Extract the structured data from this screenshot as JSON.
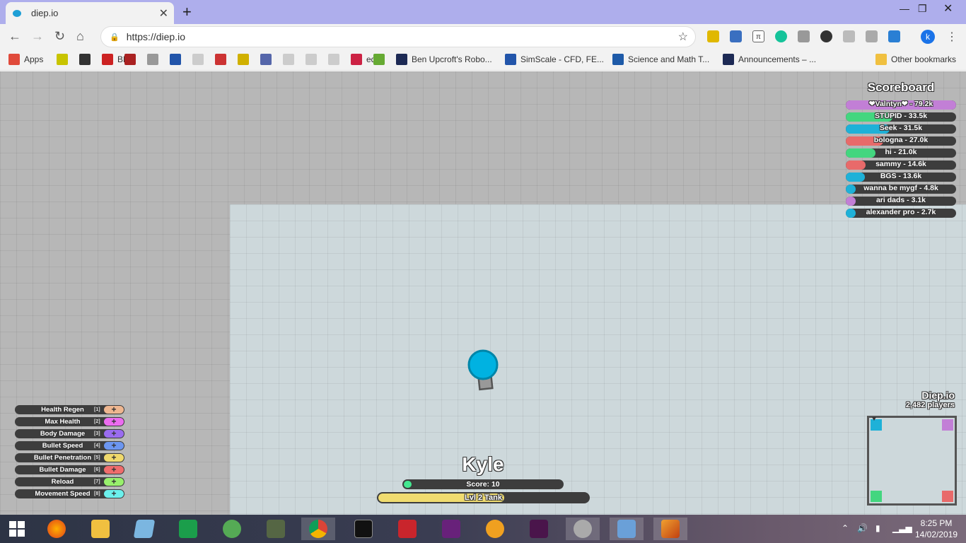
{
  "browser": {
    "tab_title": "diep.io",
    "url": "https://diep.io",
    "bookmarks": [
      {
        "label": "Apps",
        "color": "#e04a3b"
      },
      {
        "label": "",
        "color": "#c8c400"
      },
      {
        "label": "",
        "color": "#333333"
      },
      {
        "label": "BE",
        "color": "#cc2222"
      },
      {
        "label": "",
        "color": "#aa2222"
      },
      {
        "label": "",
        "color": "#999999"
      },
      {
        "label": "",
        "color": "#2255aa"
      },
      {
        "label": "",
        "color": "#cccccc"
      },
      {
        "label": "",
        "color": "#cc3333"
      },
      {
        "label": "",
        "color": "#d0b000"
      },
      {
        "label": "",
        "color": "#5566aa"
      },
      {
        "label": "",
        "color": "#cccccc"
      },
      {
        "label": "",
        "color": "#cccccc"
      },
      {
        "label": "",
        "color": "#cccccc"
      },
      {
        "label": "edX",
        "color": "#cc2244"
      },
      {
        "label": "",
        "color": "#66aa33"
      },
      {
        "label": "Ben Upcroft's Robo...",
        "color": "#1d2a55"
      },
      {
        "label": "SimScale - CFD, FE...",
        "color": "#2255aa"
      },
      {
        "label": "Science and Math T...",
        "color": "#1e5aa8"
      },
      {
        "label": "Announcements – ...",
        "color": "#1d2a55"
      }
    ],
    "other_bookmarks": "Other bookmarks"
  },
  "scoreboard": {
    "title": "Scoreboard",
    "entries": [
      {
        "label": "❤Valntyn❤ - 79.2k",
        "fraction": 1.0,
        "color": "#c27fd6"
      },
      {
        "label": "STUPID - 33.5k",
        "fraction": 0.42,
        "color": "#43d67f"
      },
      {
        "label": "Seek - 31.5k",
        "fraction": 0.4,
        "color": "#1eb1d8"
      },
      {
        "label": "bologna - 27.0k",
        "fraction": 0.34,
        "color": "#e86a6a"
      },
      {
        "label": "hi - 21.0k",
        "fraction": 0.27,
        "color": "#43d67f"
      },
      {
        "label": "sammy - 14.6k",
        "fraction": 0.18,
        "color": "#e86a6a"
      },
      {
        "label": "BGS - 13.6k",
        "fraction": 0.17,
        "color": "#1eb1d8"
      },
      {
        "label": "wanna be mygf - 4.8k",
        "fraction": 0.06,
        "color": "#1eb1d8"
      },
      {
        "label": "ari dads - 3.1k",
        "fraction": 0.04,
        "color": "#c27fd6"
      },
      {
        "label": "alexander pro - 2.7k",
        "fraction": 0.035,
        "color": "#1eb1d8"
      }
    ]
  },
  "stats": [
    {
      "label": "Health Regen",
      "key": "[1]",
      "color": "#eeb690"
    },
    {
      "label": "Max Health",
      "key": "[2]",
      "color": "#ec6cf0"
    },
    {
      "label": "Body Damage",
      "key": "[3]",
      "color": "#9a6cf0"
    },
    {
      "label": "Bullet Speed",
      "key": "[4]",
      "color": "#6c96f0"
    },
    {
      "label": "Bullet Penetration",
      "key": "[5]",
      "color": "#f0d96c"
    },
    {
      "label": "Bullet Damage",
      "key": "[6]",
      "color": "#f06c6c"
    },
    {
      "label": "Reload",
      "key": "[7]",
      "color": "#98f06c"
    },
    {
      "label": "Movement Speed",
      "key": "[8]",
      "color": "#6cf0ec"
    }
  ],
  "player": {
    "name": "Kyle",
    "score_label": "Score: 10",
    "score_fraction": 0.05,
    "level_label": "Lvl 2 Tank",
    "level_fraction": 0.6
  },
  "game": {
    "brand": "Diep.io",
    "players": "2,482 players"
  },
  "system": {
    "time": "8:25 PM",
    "date": "14/02/2019"
  }
}
